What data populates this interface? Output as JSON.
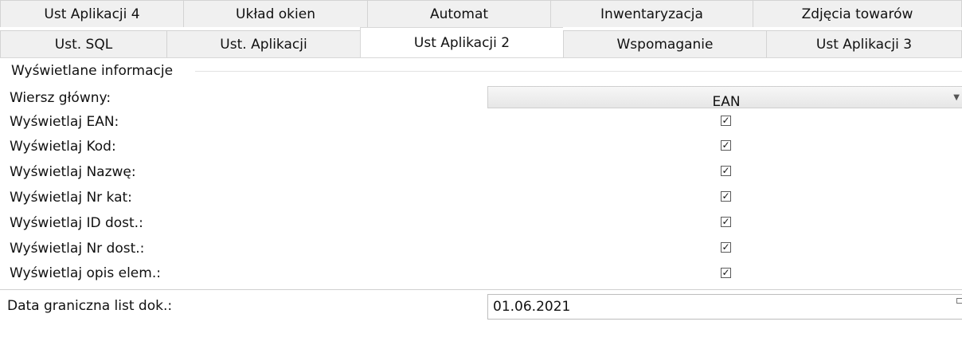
{
  "tabs_row1": [
    "Ust Aplikacji 4",
    "Układ okien",
    "Automat",
    "Inwentaryzacja",
    "Zdjęcia towarów"
  ],
  "tabs_row2": [
    "Ust. SQL",
    "Ust. Aplikacji",
    "Ust Aplikacji 2",
    "Wspomaganie",
    "Ust Aplikacji 3"
  ],
  "active_tab": "Ust Aplikacji 2",
  "group_title": "Wyświetlane informacje",
  "main_row": {
    "label": "Wiersz główny:",
    "value": "EAN"
  },
  "checkbox_rows": [
    {
      "label": "Wyświetlaj EAN:",
      "checked": true
    },
    {
      "label": "Wyświetlaj Kod:",
      "checked": true
    },
    {
      "label": "Wyświetlaj Nazwę:",
      "checked": true
    },
    {
      "label": "Wyświetlaj Nr kat:",
      "checked": true
    },
    {
      "label": "Wyświetlaj ID dost.:",
      "checked": true
    },
    {
      "label": "Wyświetlaj Nr dost.:",
      "checked": true
    },
    {
      "label": "Wyświetlaj opis elem.:",
      "checked": true
    }
  ],
  "date_field": {
    "label": "Data graniczna list dok.:",
    "value": "01.06.2021"
  },
  "checkmark_glyph": "✓"
}
